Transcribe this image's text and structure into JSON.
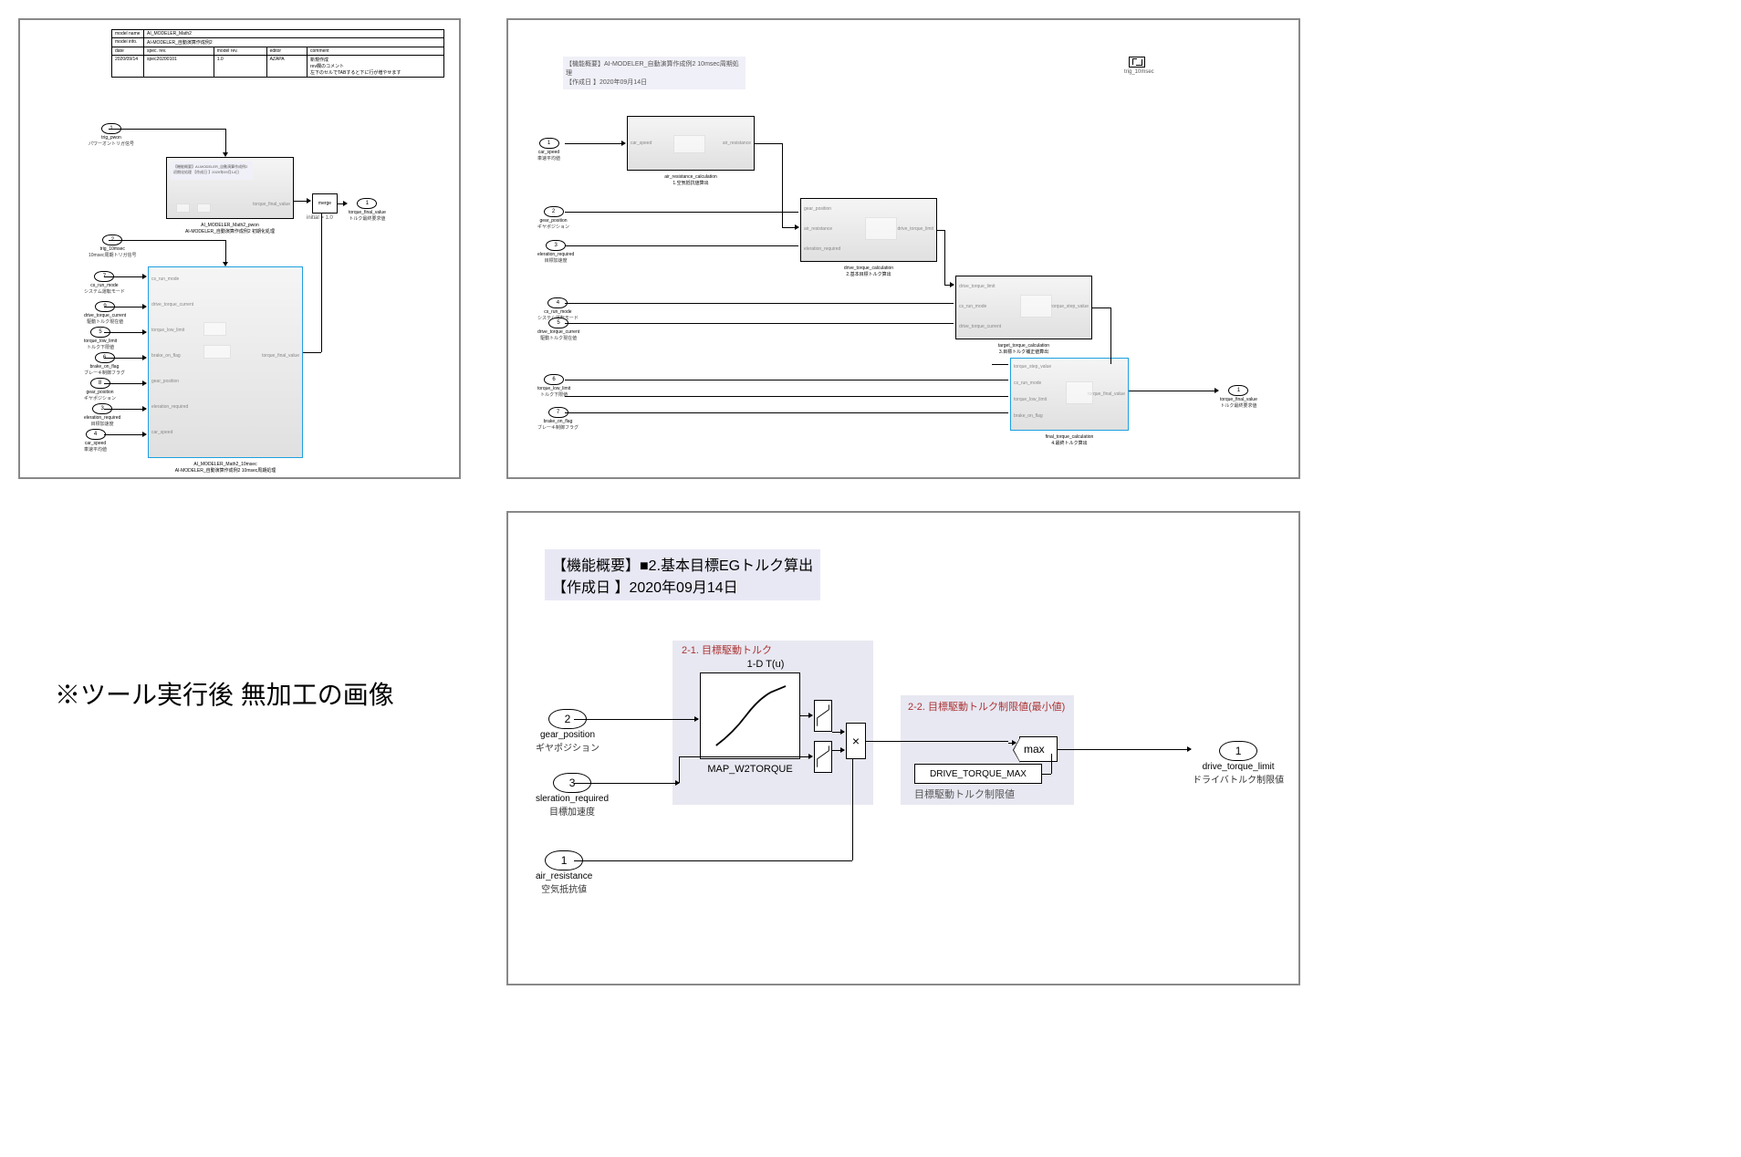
{
  "caption": "※ツール実行後 無加工の画像",
  "panel1": {
    "table": {
      "r1": {
        "label": "model name",
        "value": "AI_MODELER_Math2"
      },
      "r2": {
        "label": "model info.",
        "value": "AI-MODELER_自動演算作成例2"
      },
      "r3": {
        "date": "date",
        "specrev": "spec. rev.",
        "modelrev": "model rev.",
        "editor": "editor",
        "comment": "comment"
      },
      "r4": {
        "date": "2020/09/14",
        "specrev": "spec20200101",
        "modelrev": "1.0",
        "editor": "AZAPA",
        "comment": "新規作成\\nrev欄のコメント\\n左下のセルでTABすると下に行が増やせます"
      }
    },
    "inports": [
      {
        "num": "1",
        "name": "trig_pwon",
        "jp": "パワーオントリガ信号"
      },
      {
        "num": "2",
        "name": "trig_10msec",
        "jp": "10msec周期トリガ信号"
      },
      {
        "num": "7",
        "name": "cs_run_mode",
        "jp": "システム運転モード"
      },
      {
        "num": "9",
        "name": "drive_torque_current",
        "jp": "駆動トルク現在値"
      },
      {
        "num": "5",
        "name": "torque_low_limit",
        "jp": "トルク下限値"
      },
      {
        "num": "6",
        "name": "brake_on_flag",
        "jp": "ブレーキ制御フラグ"
      },
      {
        "num": "8",
        "name": "gear_position",
        "jp": "ギヤポジション"
      },
      {
        "num": "3",
        "name": "eleration_required",
        "jp": "目標加速度"
      },
      {
        "num": "4",
        "name": "car_speed",
        "jp": "車速平均値"
      }
    ],
    "sub_pwon": {
      "name": "AI_MODELER_Math2_pwon",
      "desc": "AI-MODELER_自動演算作成例2 初期化処理",
      "out": "torque_final_value",
      "ann": "【機能概要】AI-MODELER_自動演算作成例2 初期化処理\\n【作成日 】2020年09月14日"
    },
    "sub_10ms": {
      "name": "AI_MODELER_Math2_10msec",
      "desc": "AI-MODELER_自動演算作成例2 10msec周期処理",
      "ports": [
        "cs_run_mode",
        "drive_torque_current",
        "torque_low_limit",
        "brake_on_flag",
        "gear_position",
        "eleration_required",
        "car_speed"
      ],
      "out": "torque_final_value"
    },
    "merge": {
      "label": "merge",
      "init": "initial = 1.0"
    },
    "outport": {
      "num": "1",
      "name": "torque_final_value",
      "jp": "トルク最終要求値"
    }
  },
  "panel2": {
    "header": {
      "title": "【機能概要】AI-MODELER_自動演算作成例2 10msec周期処理",
      "date": "【作成日  】2020年09月14日"
    },
    "trig": "trig_10msec",
    "inports": [
      {
        "num": "1",
        "name": "car_speed",
        "jp": "車速平均値"
      },
      {
        "num": "2",
        "name": "gear_position",
        "jp": "ギヤポジション"
      },
      {
        "num": "3",
        "name": "eleration_required",
        "jp": "目標加速度"
      },
      {
        "num": "4",
        "name": "cs_run_mode",
        "jp": "システム運転モード"
      },
      {
        "num": "5",
        "name": "drive_torque_current",
        "jp": "駆動トルク現在値"
      },
      {
        "num": "6",
        "name": "torque_low_limit",
        "jp": "トルク下限値"
      },
      {
        "num": "7",
        "name": "brake_on_flag",
        "jp": "ブレーキ制御フラグ"
      }
    ],
    "sub1": {
      "name": "air_resistance_calculation",
      "jp": "1.空気抵抗値算出",
      "in": "car_speed",
      "out": "air_resistance"
    },
    "sub2": {
      "name": "drive_torque_calculation",
      "jp": "2.基本目標トルク算出",
      "ins": [
        "gear_position",
        "air_resistance",
        "eleration_required"
      ],
      "out": "drive_torque_limit"
    },
    "sub3": {
      "name": "target_torque_calculation",
      "jp": "3.目標トルク補正値算出",
      "ins": [
        "drive_torque_limit",
        "cs_run_mode",
        "drive_torque_current"
      ],
      "out": "torque_step_value"
    },
    "sub4": {
      "name": "final_torque_calculation",
      "jp": "4.最終トルク算出",
      "ins": [
        "torque_step_value",
        "cs_run_mode",
        "torque_low_limit",
        "brake_on_flag"
      ],
      "out": "torque_final_value"
    },
    "outport": {
      "num": "1",
      "name": "torque_final_value",
      "jp": "トルク最終要求値"
    }
  },
  "panel3": {
    "header": {
      "title": "【機能概要】■2.基本目標EGトルク算出",
      "date": "【作成日  】2020年09月14日"
    },
    "zone1": "2-1. 目標駆動トルク",
    "zone2": "2-2. 目標駆動トルク制限値(最小値)",
    "lut": {
      "title": "1-D T(u)",
      "name": "MAP_W2TORQUE"
    },
    "const": {
      "name": "DRIVE_TORQUE_MAX",
      "jp": "目標駆動トルク制限値"
    },
    "max": "max",
    "mult": "×",
    "inports": [
      {
        "num": "2",
        "name": "gear_position",
        "jp": "ギヤポジション"
      },
      {
        "num": "3",
        "name": "sleration_required",
        "jp": "目標加速度"
      },
      {
        "num": "1",
        "name": "air_resistance",
        "jp": "空気抵抗値"
      }
    ],
    "outport": {
      "num": "1",
      "name": "drive_torque_limit",
      "jp": "ドライバトルク制限値"
    }
  }
}
